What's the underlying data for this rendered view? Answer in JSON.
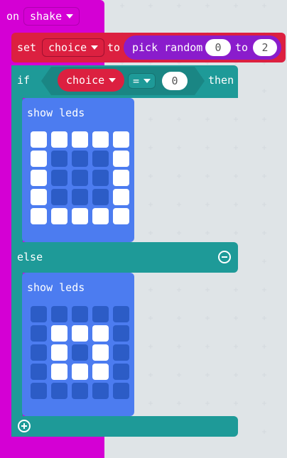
{
  "event_block": {
    "label": "on",
    "event": "shake"
  },
  "set_block": {
    "label": "set",
    "variable": "choice",
    "to_label": "to"
  },
  "random_block": {
    "label": "pick random",
    "min": "0",
    "to_label": "to",
    "max": "2"
  },
  "if_block": {
    "if_label": "if",
    "variable": "choice",
    "operator": "=",
    "value": "0",
    "then_label": "then",
    "else_label": "else"
  },
  "show_leds_1": {
    "label": "show leds",
    "grid": [
      [
        1,
        1,
        1,
        1,
        1
      ],
      [
        1,
        0,
        0,
        0,
        1
      ],
      [
        1,
        0,
        0,
        0,
        1
      ],
      [
        1,
        0,
        0,
        0,
        1
      ],
      [
        1,
        1,
        1,
        1,
        1
      ]
    ]
  },
  "show_leds_2": {
    "label": "show leds",
    "grid": [
      [
        0,
        0,
        0,
        0,
        0
      ],
      [
        0,
        1,
        1,
        1,
        0
      ],
      [
        0,
        1,
        0,
        1,
        0
      ],
      [
        0,
        1,
        1,
        1,
        0
      ],
      [
        0,
        0,
        0,
        0,
        0
      ]
    ]
  },
  "icons": {
    "remove_else": "minus-circle-icon",
    "add_branch": "plus-circle-icon"
  },
  "colors": {
    "events": "#d400d4",
    "variables": "#dc2040",
    "math": "#8a1ccc",
    "logic": "#1e9a98",
    "basic": "#4c7cf0",
    "led_on": "#ffffff",
    "led_off": "#2c5cc6"
  }
}
